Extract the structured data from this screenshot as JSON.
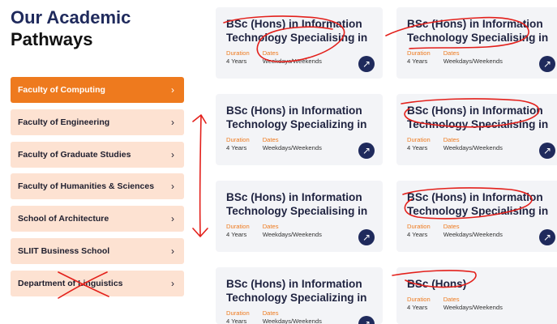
{
  "heading": {
    "line1": "Our Academic",
    "line2": "Pathways"
  },
  "faculties": [
    {
      "label": "Faculty of Computing",
      "active": true
    },
    {
      "label": "Faculty of Engineering",
      "active": false
    },
    {
      "label": "Faculty of Graduate Studies",
      "active": false
    },
    {
      "label": "Faculty of Humanities & Sciences",
      "active": false
    },
    {
      "label": "School of Architecture",
      "active": false
    },
    {
      "label": "SLIIT Business School",
      "active": false
    },
    {
      "label": "Department of Linguistics",
      "active": false
    }
  ],
  "chevron": "›",
  "arrow_glyph": "↗",
  "cards": [
    {
      "title": "BSc (Hons) in Information Technology Specialising in",
      "duration_label": "Duration",
      "duration": "4 Years",
      "dates_label": "Dates",
      "dates": "Weekdays/Weekends"
    },
    {
      "title": "BSc (Hons) in Information Technology Specialising in",
      "duration_label": "Duration",
      "duration": "4 Years",
      "dates_label": "Dates",
      "dates": "Weekdays/Weekends"
    },
    {
      "title": "BSc (Hons) in Information Technology Specializing in",
      "duration_label": "Duration",
      "duration": "4 Years",
      "dates_label": "Dates",
      "dates": "Weekdays/Weekends"
    },
    {
      "title": "BSc (Hons) in Information Technology Specialising in",
      "duration_label": "Duration",
      "duration": "4 Years",
      "dates_label": "Dates",
      "dates": "Weekdays/Weekends"
    },
    {
      "title": "BSc (Hons) in Information Technology Specialising in",
      "duration_label": "Duration",
      "duration": "4 Years",
      "dates_label": "Dates",
      "dates": "Weekdays/Weekends"
    },
    {
      "title": "BSc (Hons) in Information Technology Specialising in",
      "duration_label": "Duration",
      "duration": "4 Years",
      "dates_label": "Dates",
      "dates": "Weekdays/Weekends"
    },
    {
      "title": "BSc (Hons) in Information Technology Specializing in",
      "duration_label": "Duration",
      "duration": "4 Years",
      "dates_label": "Dates",
      "dates": "Weekdays/Weekends"
    },
    {
      "title": "BSc (Hons)",
      "duration_label": "Duration",
      "duration": "4 Years",
      "dates_label": "Dates",
      "dates": "Weekdays/Weekends"
    }
  ],
  "colors": {
    "accent": "#ee7a1e",
    "navy": "#1f2a5c",
    "tab_bg": "#fde2d2",
    "card_bg": "#f3f4f7",
    "annotation": "#e3201b"
  }
}
